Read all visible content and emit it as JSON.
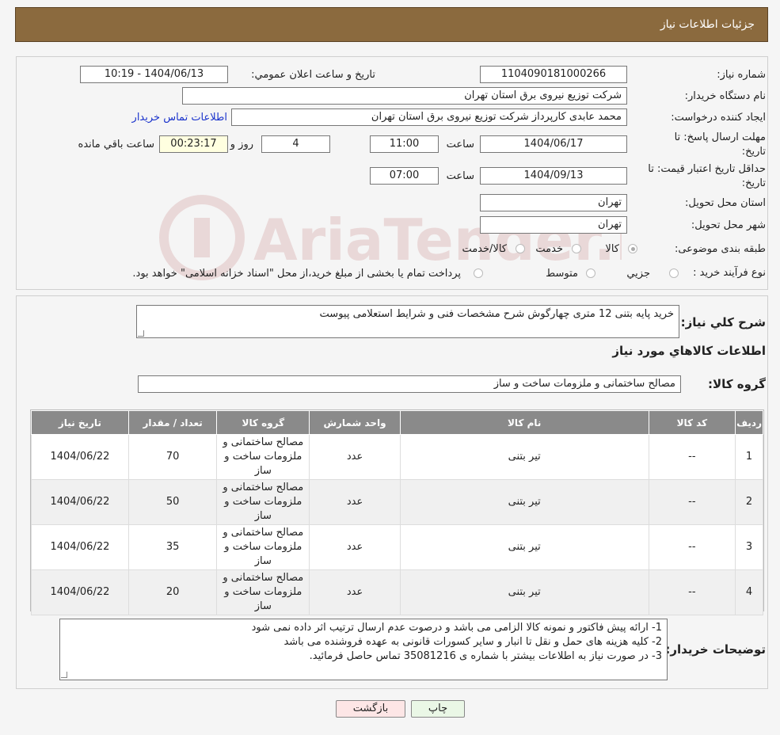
{
  "header": {
    "title": "جزئیات اطلاعات نیاز"
  },
  "need": {
    "number_label": "شماره نیاز:",
    "number": "1104090181000266",
    "announce_label": "تاریخ و ساعت اعلان عمومي:",
    "announce_value": "1404/06/13 - 10:19",
    "buyer_org_label": "نام دستگاه خریدار:",
    "buyer_org": "شرکت توزیع نیروی برق استان تهران",
    "creator_label": "ایجاد کننده درخواست:",
    "creator": "محمد عابدی کارپرداز شرکت توزیع نیروی برق استان تهران",
    "contact_link": "اطلاعات تماس خریدار",
    "deadline_label_1": "مهلت ارسال پاسخ: تا",
    "deadline_label_2": "تاریخ:",
    "deadline_date": "1404/06/17",
    "time_label": "ساعت",
    "deadline_time": "11:00",
    "days_value": "4",
    "days_label": "روز و",
    "remaining_time": "00:23:17",
    "remaining_label": "ساعت باقي مانده",
    "validity_label_1": "حداقل تاریخ اعتبار قیمت: تا",
    "validity_label_2": "تاریخ:",
    "validity_date": "1404/09/13",
    "validity_time": "07:00",
    "province_label": "استان محل تحویل:",
    "province": "تهران",
    "city_label": "شهر محل تحویل:",
    "city": "تهران",
    "category_label": "طبقه بندی موضوعی:",
    "category_options": [
      "کالا",
      "خدمت",
      "کالا/خدمت"
    ],
    "category_selected": "کالا",
    "process_label": "نوع فرآیند خرید :",
    "process_options": [
      "جزیي",
      "متوسط"
    ],
    "process_note": "پرداخت تمام یا بخشی از مبلغ خرید،از محل \"اسناد خزانه اسلامی\" خواهد بود.",
    "watermark": "AriaTender.neT"
  },
  "summary": {
    "label": "شرح کلي نیاز:",
    "text": "خرید پایه بتنی 12 متری چهارگوش شرح مشخصات فنی و شرایط استعلامی پیوست"
  },
  "goods": {
    "section_title": "اطلاعات کالاهاي مورد نیاز",
    "group_label": "گروه کالا:",
    "group_value": "مصالح ساختمانی و ملزومات ساخت و ساز",
    "columns": [
      "ردیف",
      "کد کالا",
      "نام کالا",
      "واحد شمارش",
      "گروه کالا",
      "تعداد / مقدار",
      "تاریخ نیاز"
    ],
    "rows": [
      {
        "row": "1",
        "code": "--",
        "name": "تیر بتنی",
        "unit": "عدد",
        "group": "مصالح ساختمانی و ملزومات ساخت و ساز",
        "qty": "70",
        "date": "1404/06/22"
      },
      {
        "row": "2",
        "code": "--",
        "name": "تیر بتنی",
        "unit": "عدد",
        "group": "مصالح ساختمانی و ملزومات ساخت و ساز",
        "qty": "50",
        "date": "1404/06/22"
      },
      {
        "row": "3",
        "code": "--",
        "name": "تیر بتنی",
        "unit": "عدد",
        "group": "مصالح ساختمانی و ملزومات ساخت و ساز",
        "qty": "35",
        "date": "1404/06/22"
      },
      {
        "row": "4",
        "code": "--",
        "name": "تیر بتنی",
        "unit": "عدد",
        "group": "مصالح ساختمانی و ملزومات ساخت و ساز",
        "qty": "20",
        "date": "1404/06/22"
      }
    ]
  },
  "notes": {
    "label": "توضیحات خریدار:",
    "lines": [
      "1- ارائه پیش فاکتور و نمونه کالا الزامی می باشد و درصوت عدم ارسال ترتیب اثر داده نمی شود",
      "2- کلیه هزینه های حمل و نقل تا انبار و سایر کسورات قانونی به عهده فروشنده می باشد",
      "3- در صورت نیاز به اطلاعات بیشتر با شماره ی 35081216 تماس حاصل فرمائید."
    ]
  },
  "buttons": {
    "print": "چاپ",
    "back": "بازگشت"
  },
  "colors": {
    "header_bg": "#8b6a3e",
    "table_header": "#8a8a8a",
    "back_button": "#fde6e6",
    "print_button": "#eaf7e6",
    "link": "#1a33cc"
  }
}
